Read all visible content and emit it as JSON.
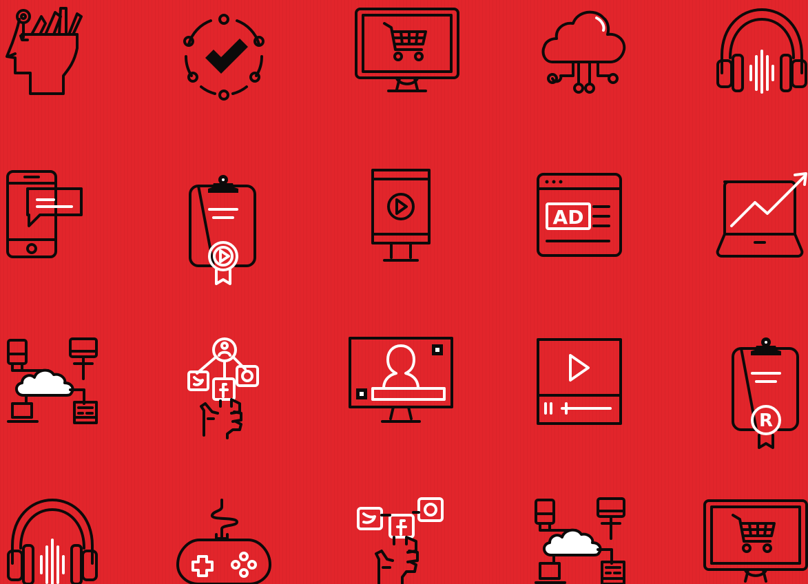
{
  "colors": {
    "background": "#e2252b",
    "outline": "#0c0a0a",
    "accent": "#ffffff"
  },
  "icons": [
    {
      "name": "creative-mind-icon"
    },
    {
      "name": "check-cycle-icon"
    },
    {
      "name": "shopping-cart-monitor-icon"
    },
    {
      "name": "cloud-network-icon"
    },
    {
      "name": "headphones-audio-icon"
    },
    {
      "name": "mobile-chat-icon"
    },
    {
      "name": "video-award-clipboard-icon"
    },
    {
      "name": "video-kiosk-icon"
    },
    {
      "name": "ad-browser-icon",
      "label": "AD"
    },
    {
      "name": "laptop-growth-chart-icon"
    },
    {
      "name": "cloud-device-network-icon"
    },
    {
      "name": "social-media-hand-icon"
    },
    {
      "name": "video-call-monitor-icon"
    },
    {
      "name": "video-player-icon"
    },
    {
      "name": "registered-clipboard-icon",
      "label": "R"
    },
    {
      "name": "headphones-audio-icon"
    },
    {
      "name": "game-controller-icon"
    },
    {
      "name": "social-media-hand-icon"
    },
    {
      "name": "cloud-device-network-icon"
    },
    {
      "name": "shopping-cart-monitor-icon"
    }
  ]
}
